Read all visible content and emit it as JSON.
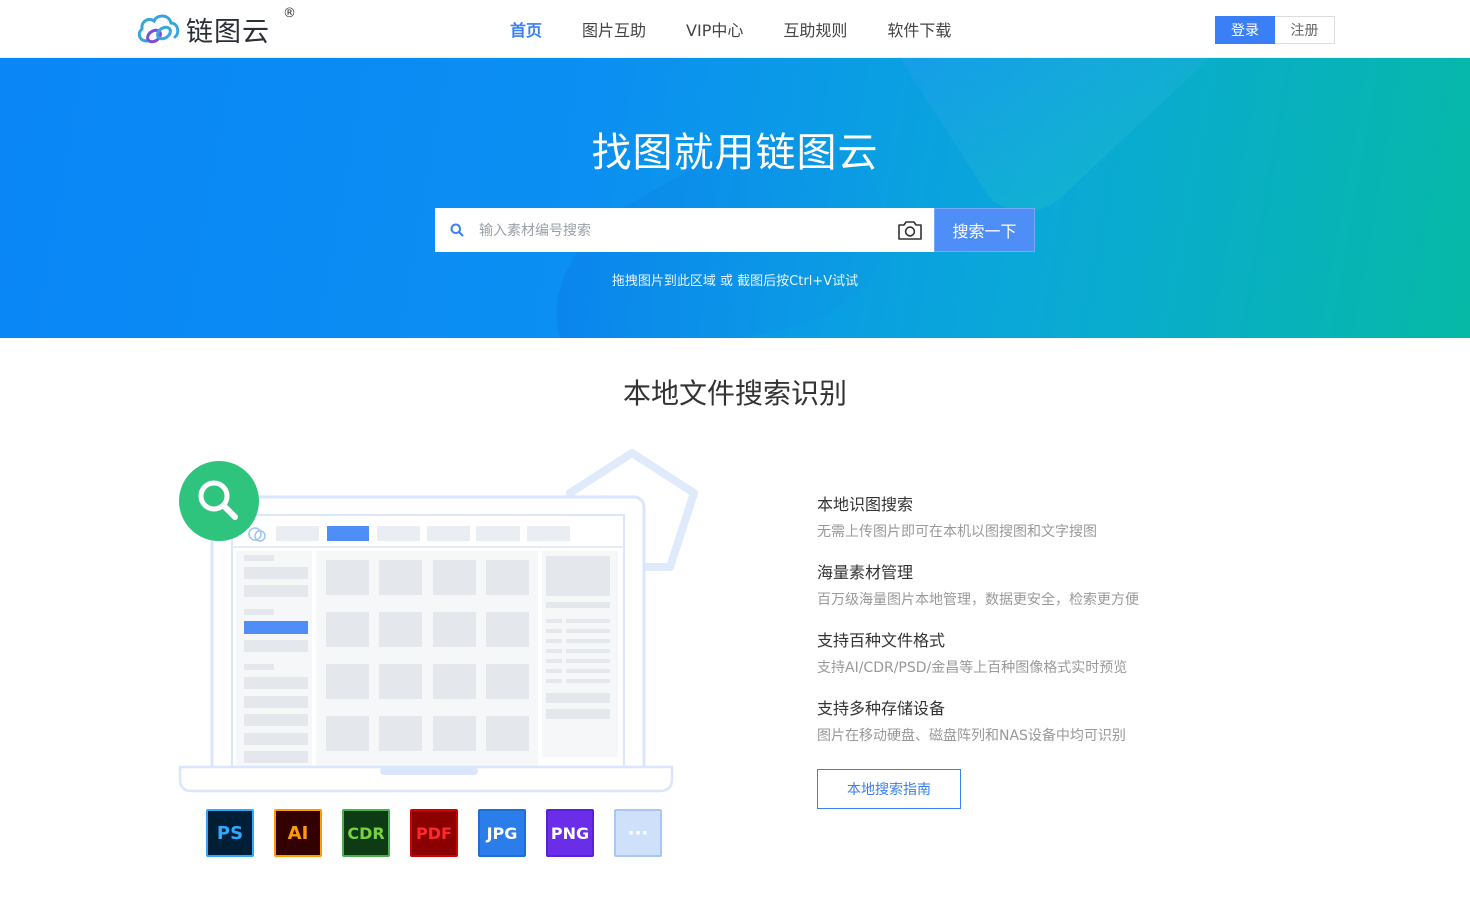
{
  "header": {
    "logo_text": "链图云",
    "logo_reg": "®",
    "nav": [
      {
        "label": "首页",
        "active": true
      },
      {
        "label": "图片互助",
        "active": false
      },
      {
        "label": "VIP中心",
        "active": false
      },
      {
        "label": "互助规则",
        "active": false
      },
      {
        "label": "软件下载",
        "active": false
      }
    ],
    "login_label": "登录",
    "register_label": "注册"
  },
  "hero": {
    "title": "找图就用链图云",
    "search_placeholder": "输入素材编号搜索",
    "search_button": "搜索一下",
    "hint": "拖拽图片到此区域 或 截图后按Ctrl+V试试"
  },
  "section": {
    "title": "本地文件搜索识别",
    "features": [
      {
        "title": "本地识图搜索",
        "desc": "无需上传图片即可在本机以图搜图和文字搜图"
      },
      {
        "title": "海量素材管理",
        "desc": "百万级海量图片本地管理，数据更安全，检索更方便"
      },
      {
        "title": "支持百种文件格式",
        "desc": "支持AI/CDR/PSD/金昌等上百种图像格式实时预览"
      },
      {
        "title": "支持多种存储设备",
        "desc": "图片在移动硬盘、磁盘阵列和NAS设备中均可识别"
      }
    ],
    "guide_button": "本地搜索指南",
    "formats": [
      {
        "label": "PS",
        "bg": "#001e36",
        "fg": "#31a8ff",
        "border": "#31a8ff"
      },
      {
        "label": "AI",
        "bg": "#330000",
        "fg": "#ff9a00",
        "border": "#ff9a00"
      },
      {
        "label": "CDR",
        "bg": "#0d3b14",
        "fg": "#7ad13f",
        "border": "#4caf50"
      },
      {
        "label": "PDF",
        "bg": "#8b0000",
        "fg": "#ff2a2a",
        "border": "#d40000"
      },
      {
        "label": "JPG",
        "bg": "#2b7de9",
        "fg": "#ffffff",
        "border": "#1c6fd8"
      },
      {
        "label": "PNG",
        "bg": "#6a2ee8",
        "fg": "#ffffff",
        "border": "#5a1fd8"
      },
      {
        "label": "···",
        "bg": "#cfe0fb",
        "fg": "#ffffff",
        "border": "#aac6f5"
      }
    ]
  },
  "colors": {
    "accent": "#3a7ff6",
    "hero_start": "#0a86f6",
    "hero_end": "#06b9a6",
    "search_badge": "#2ec47d"
  }
}
